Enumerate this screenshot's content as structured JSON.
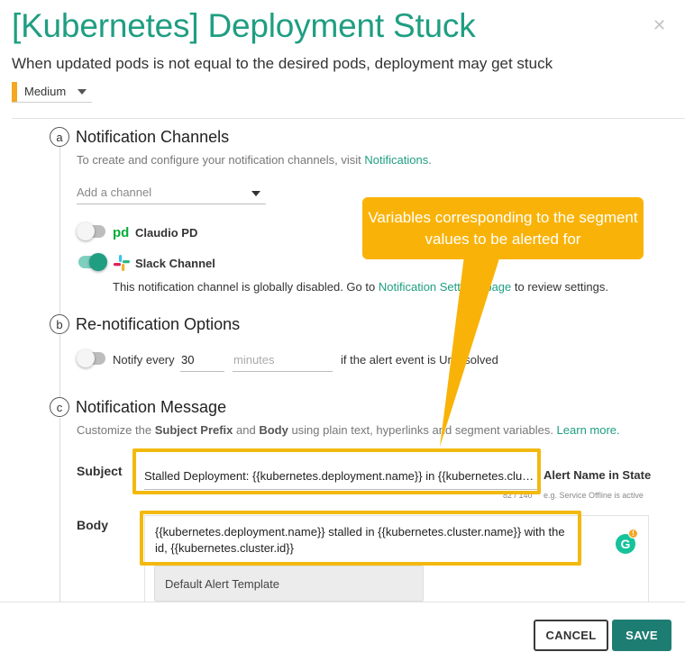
{
  "dialog": {
    "title": "[Kubernetes] Deployment Stuck",
    "description": "When updated pods is not equal to the desired pods, deployment may get stuck",
    "close_icon": "close-icon",
    "severity": {
      "label": "Medium",
      "color": "#f5a623"
    }
  },
  "sections": {
    "channels": {
      "step": "a",
      "title": "Notification Channels",
      "hint_text": "To create and configure your notification channels, visit ",
      "hint_link": "Notifications",
      "hint_end": ".",
      "add_channel_placeholder": "Add a channel",
      "channels": [
        {
          "name": "Claudio PD",
          "enabled": false,
          "icon": "pagerduty-icon"
        },
        {
          "name": "Slack Channel",
          "enabled": true,
          "icon": "slack-icon"
        }
      ],
      "disabled_notice_pre": "This notification channel is globally disabled. Go to ",
      "disabled_notice_link": "Notification Settings page",
      "disabled_notice_post": " to review settings."
    },
    "renotify": {
      "step": "b",
      "title": "Re-notification Options",
      "toggle_enabled": false,
      "notify_label": "Notify every",
      "interval_value": "30",
      "unit_placeholder": "minutes",
      "suffix": "if the alert event is Unresolved"
    },
    "message": {
      "step": "c",
      "title": "Notification Message",
      "hint_pre": "Customize the ",
      "hint_b1": "Subject Prefix",
      "hint_mid": " and ",
      "hint_b2": "Body",
      "hint_post": " using plain text, hyperlinks and segment variables. ",
      "hint_link": "Learn more.",
      "subject_label": "Subject",
      "subject_value": "Stalled Deployment: {{kubernetes.deployment.name}} in {{kubernetes.cluster.name}}",
      "alert_name_label": "Alert Name in State",
      "char_counter": "82 / 140",
      "example_hint": "e.g. Service Offline is active",
      "body_label": "Body",
      "body_value": "{{kubernetes.deployment.name}} stalled in {{kubernetes.cluster.name}} with the id, {{kubernetes.cluster.id}}",
      "template_button": "Default Alert Template"
    }
  },
  "callout": {
    "text": "Variables corresponding to the segment values to be alerted for",
    "color": "#f9b308"
  },
  "highlight_color": "#f2b90f",
  "footer": {
    "cancel_label": "CANCEL",
    "save_label": "SAVE",
    "save_color": "#1e7d72"
  },
  "accent_color": "#1f9e82"
}
